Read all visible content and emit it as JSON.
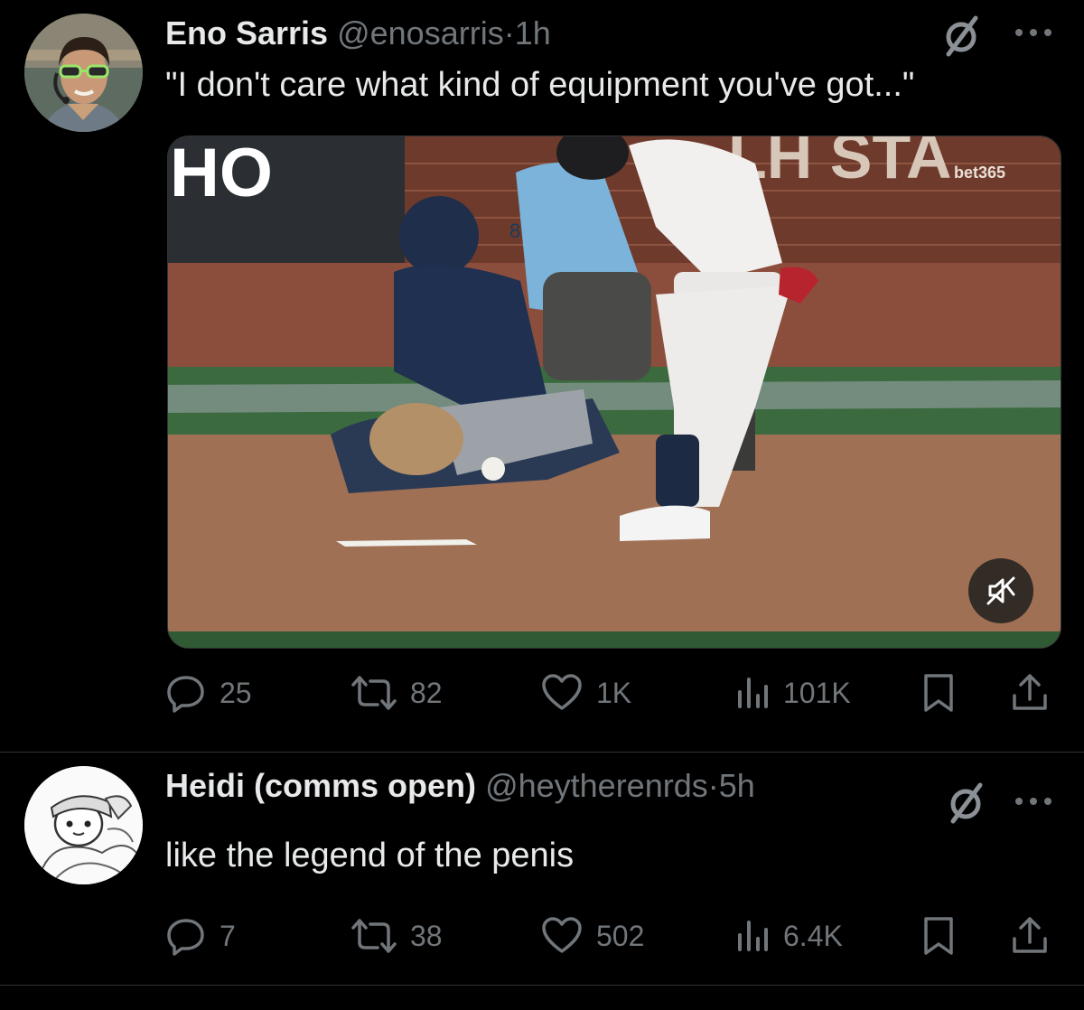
{
  "tweets": [
    {
      "author_name": "Eno Sarris",
      "handle": "@enosarris",
      "separator": "·",
      "time": "1h",
      "text": "\"I don't care what kind of equipment you've got...\"",
      "media": {
        "type": "video",
        "scoreboard_text": "HO",
        "wall_text": "LH STA",
        "sponsor_text": "bet365",
        "uniform_text": "8",
        "muted": true
      },
      "stats": {
        "replies": "25",
        "reposts": "82",
        "likes": "1K",
        "views": "101K"
      }
    },
    {
      "author_name": "Heidi (comms open)",
      "handle": "@heytherenrds",
      "separator": "·",
      "time": "5h",
      "text": "like the legend of the penis",
      "stats": {
        "replies": "7",
        "reposts": "38",
        "likes": "502",
        "views": "6.4K"
      }
    }
  ],
  "icons": {
    "reply": "reply-icon",
    "repost": "repost-icon",
    "like": "heart-icon",
    "views": "views-chart-icon",
    "bookmark": "bookmark-icon",
    "share": "share-icon",
    "grok": "grok-slash-icon",
    "more": "more-icon",
    "mute": "speaker-muted-icon"
  },
  "colors": {
    "background": "#000000",
    "text_primary": "#e7e9ea",
    "text_secondary": "#71767b",
    "divider": "#2f3336"
  }
}
